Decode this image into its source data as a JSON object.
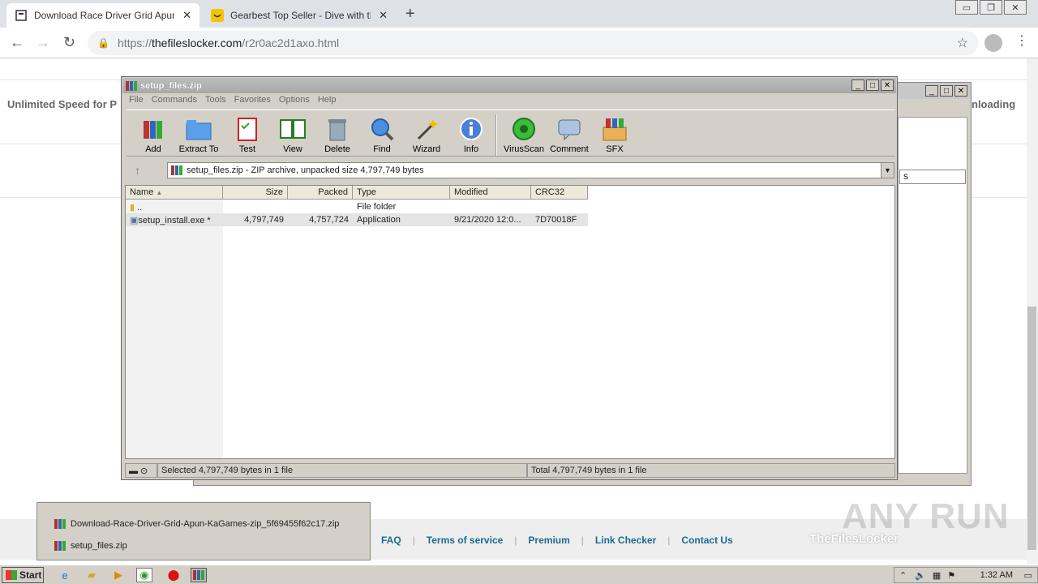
{
  "browser": {
    "tabs": [
      {
        "title": "Download Race Driver Grid Apun Ka",
        "active": true
      },
      {
        "title": "Gearbest Top Seller - Dive with the C",
        "active": false
      }
    ],
    "url_domain": "thefileslocker.com",
    "url_path": "/r2r0ac2d1axo.html",
    "url_prefix": "https://"
  },
  "page": {
    "left_text": "Unlimited Speed for P",
    "right_text": "nloading",
    "footer_links": [
      "FAQ",
      "Terms of service",
      "Premium",
      "Link Checker",
      "Contact Us"
    ],
    "brand": "TheFilesLocker",
    "watermark": "ANY RUN"
  },
  "winrar": {
    "title": "setup_files.zip",
    "menu": [
      "File",
      "Commands",
      "Tools",
      "Favorites",
      "Options",
      "Help"
    ],
    "tools": [
      "Add",
      "Extract To",
      "Test",
      "View",
      "Delete",
      "Find",
      "Wizard",
      "Info",
      "VirusScan",
      "Comment",
      "SFX"
    ],
    "address": "setup_files.zip - ZIP archive, unpacked size 4,797,749 bytes",
    "columns": [
      "Name",
      "Size",
      "Packed",
      "Type",
      "Modified",
      "CRC32"
    ],
    "rows": [
      {
        "name": "..",
        "size": "",
        "packed": "",
        "type": "File folder",
        "modified": "",
        "crc": ""
      },
      {
        "name": "setup_install.exe *",
        "size": "4,797,749",
        "packed": "4,757,724",
        "type": "Application",
        "modified": "9/21/2020 12:0...",
        "crc": "7D70018F"
      }
    ],
    "status_left": "Selected 4,797,749 bytes in 1 file",
    "status_right": "Total 4,797,749 bytes in 1 file"
  },
  "back_window": {
    "combo_text": "s"
  },
  "popup": {
    "items": [
      "Download-Race-Driver-Grid-Apun-KaGames-zip_5f69455f62c17.zip",
      "setup_files.zip"
    ]
  },
  "taskbar": {
    "start": "Start",
    "clock": "1:32 AM"
  }
}
